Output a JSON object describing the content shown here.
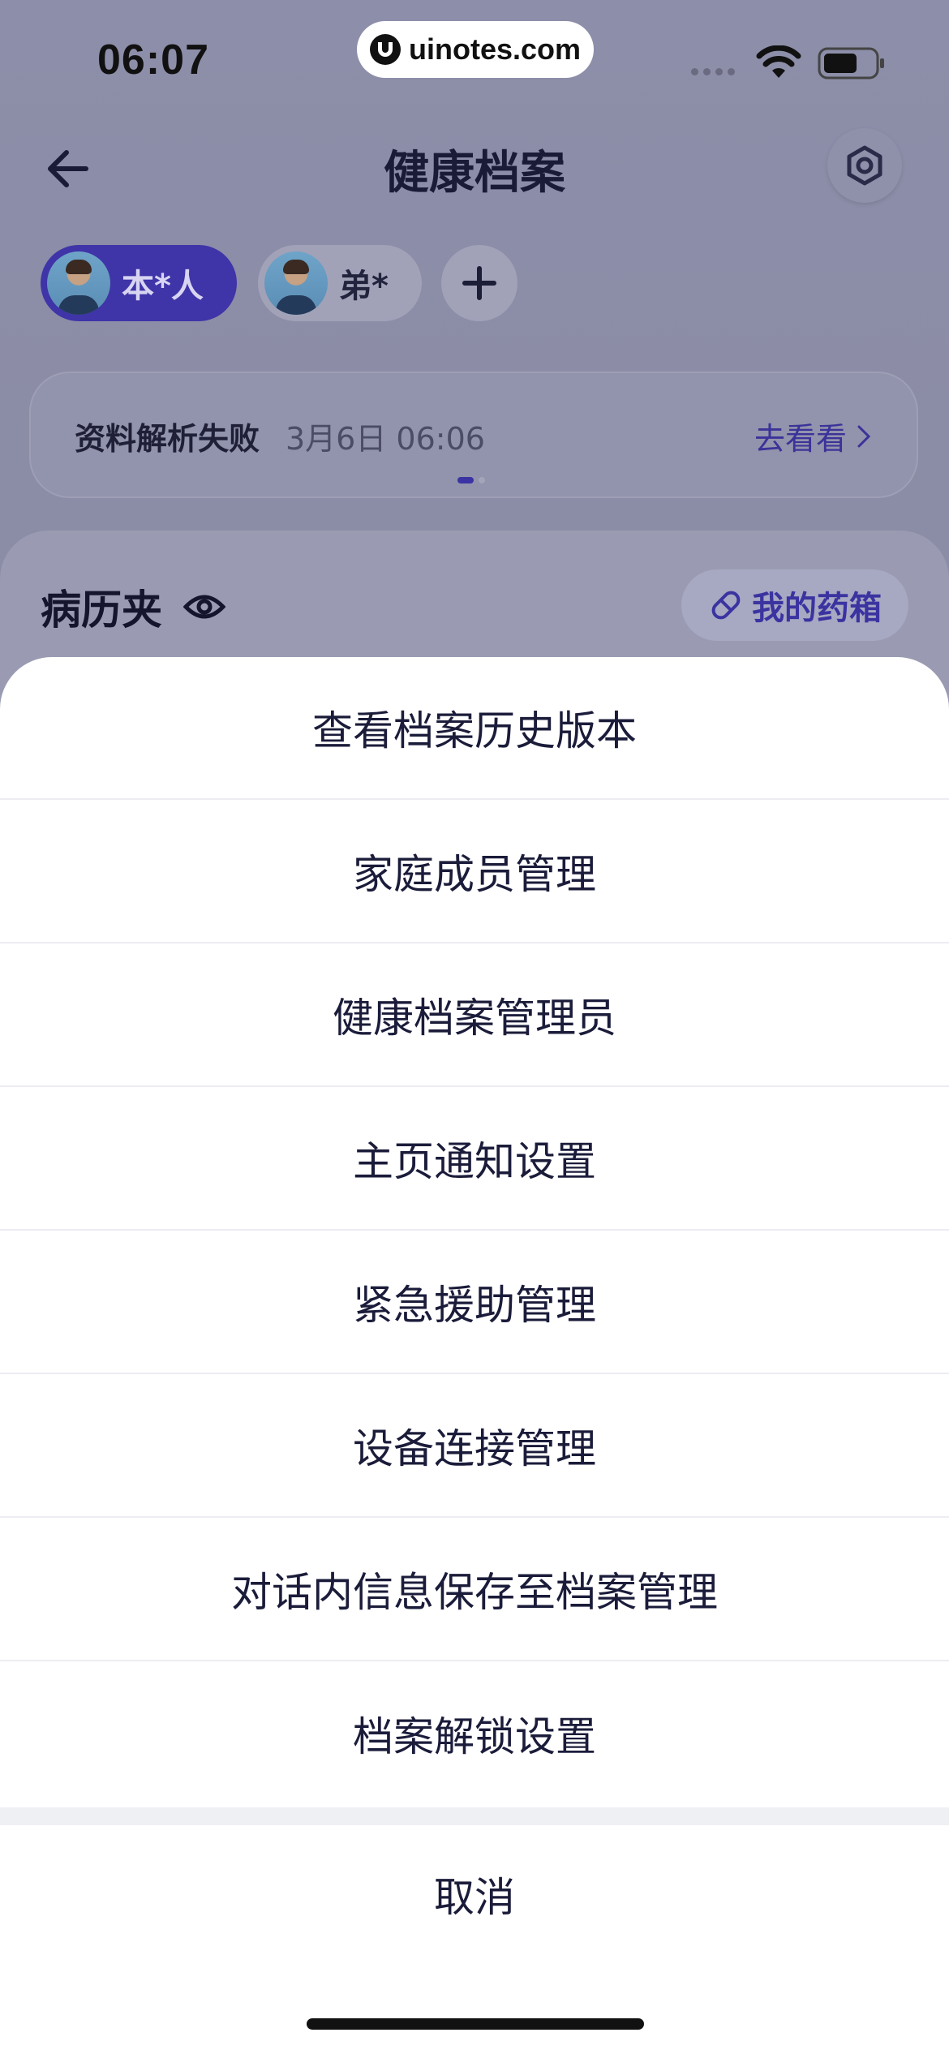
{
  "status_bar": {
    "time": "06:07",
    "watermark": "uinotes.com"
  },
  "nav": {
    "title": "健康档案"
  },
  "members": [
    {
      "name": "本*人",
      "active": true
    },
    {
      "name": "弟*",
      "active": false
    }
  ],
  "notice": {
    "title": "资料解析失败",
    "time": "3月6日 06:06",
    "link": "去看看"
  },
  "records_card": {
    "title": "病历夹",
    "medbox_label": "我的药箱"
  },
  "action_sheet": {
    "items": [
      "查看档案历史版本",
      "家庭成员管理",
      "健康档案管理员",
      "主页通知设置",
      "紧急援助管理",
      "设备连接管理",
      "对话内信息保存至档案管理",
      "档案解锁设置"
    ],
    "cancel": "取消"
  },
  "colors": {
    "accent": "#3f34a8",
    "overlay_bg": "#8a8ba3",
    "sheet_bg": "#ffffff",
    "text": "#1b1c3a"
  }
}
